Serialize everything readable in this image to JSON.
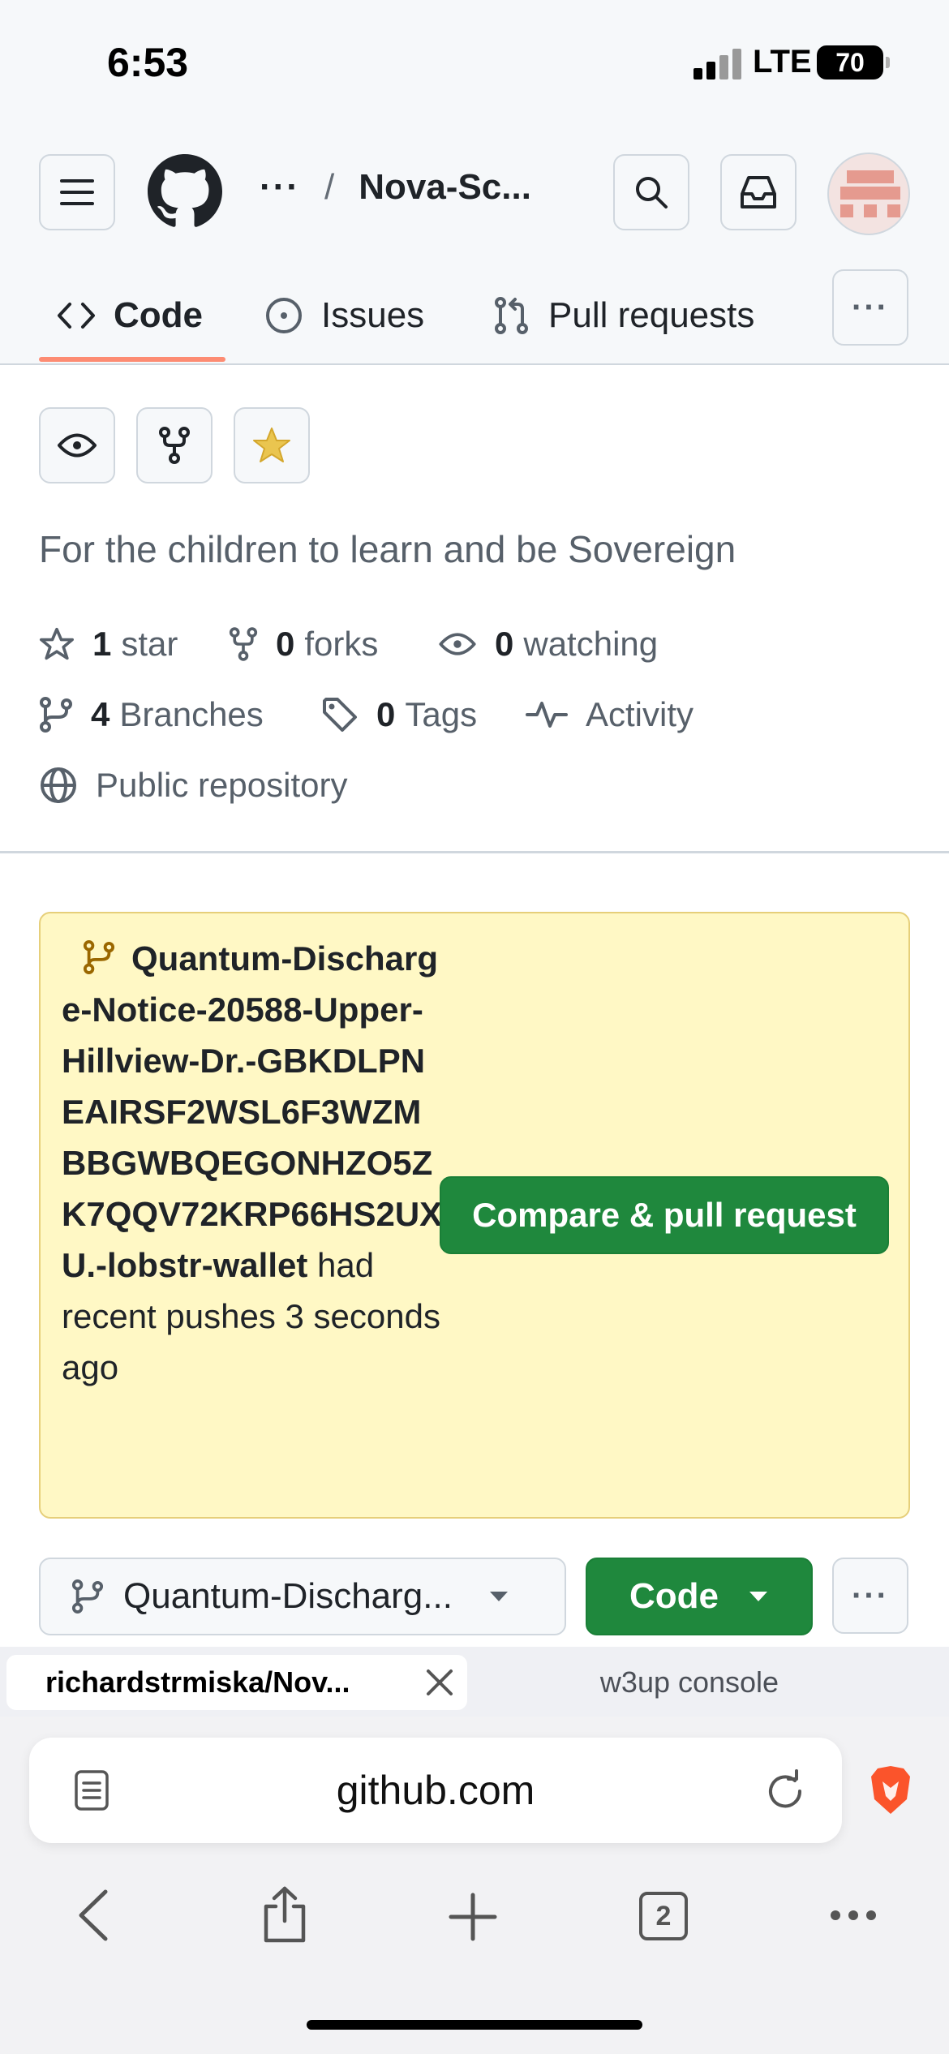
{
  "status_bar": {
    "time": "6:53",
    "network": "LTE",
    "battery": "70"
  },
  "header": {
    "breadcrumb_more": "···",
    "breadcrumb_sep": "/",
    "repo_name": "Nova-Sc..."
  },
  "tabs": [
    {
      "label": "Code",
      "icon": "code-icon",
      "selected": true
    },
    {
      "label": "Issues",
      "icon": "issue-opened-icon"
    },
    {
      "label": "Pull requests",
      "icon": "git-pull-request-icon"
    }
  ],
  "tabs_more": "···",
  "repo": {
    "description": "For the children to learn and be Sovereign",
    "stars_count": "1",
    "stars_label": "star",
    "forks_count": "0",
    "forks_label": "forks",
    "watching_count": "0",
    "watching_label": "watching",
    "branches_count": "4",
    "branches_label": "Branches",
    "tags_count": "0",
    "tags_label": "Tags",
    "activity_label": "Activity",
    "visibility": "Public repository"
  },
  "banner": {
    "branch_name": "Quantum-Discharge-Notice-20588-Upper-Hillview-Dr.-GBKDLPNEAIRSF2WSL6F3WZMBBGWBQEGONHZO5ZK7QQV72KRP66HS2UXU.-lobstr-wallet",
    "suffix": " had recent pushes 3 seconds ago",
    "button_label": "Compare & pull request"
  },
  "branch_row": {
    "selected_branch": "Quantum-Discharg...",
    "code_button": "Code",
    "more": "···"
  },
  "browser": {
    "active_tab": "richardstrmiska/Nov...",
    "inactive_tab": "w3up console",
    "url": "github.com",
    "tab_count": "2"
  },
  "colors": {
    "primary_green": "#1f883d",
    "tab_underline": "#fd8c73",
    "banner_bg": "#fff8c5",
    "star_yellow": "#eac54f",
    "brave_orange": "#fb542b"
  }
}
